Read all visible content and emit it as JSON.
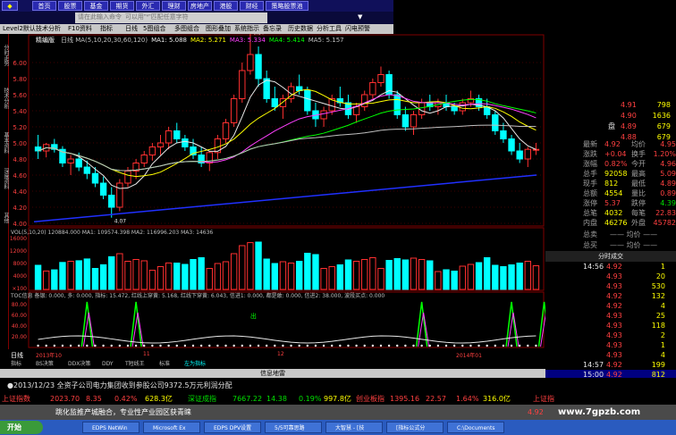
{
  "menubar": {
    "buttons": [
      "首页",
      "股票",
      "基金",
      "期货",
      "外汇",
      "理财",
      "房地产",
      "港股",
      "财经",
      "策略股票池"
    ]
  },
  "cmdbar": {
    "placeholder": "请在此输入命令  可以用\"*\"匹配任意字符",
    "dropdown": "▼"
  },
  "toolbar": {
    "items": [
      "Level2默认",
      "技术分析",
      "F10资料",
      "指标",
      "日线",
      "5图组合",
      "多图组合",
      "图形叠加",
      "系统指示",
      "备忘录",
      "历史数据",
      "分析工具",
      "闪电预警"
    ]
  },
  "lefttabs": [
    "分时走势",
    "技术分析",
    "基本资料",
    "深度资料",
    "其他"
  ],
  "chart": {
    "code_label": "精编版",
    "ma_legend": [
      {
        "text": "日线 MA(5,10,20,30,60,120)",
        "color": "#c0c0c0"
      },
      {
        "text": "MA1: 5.088",
        "color": "#e8e8e8"
      },
      {
        "text": "MA2: 5.271",
        "color": "#ffff00"
      },
      {
        "text": "MA3: 5.334",
        "color": "#ff40ff"
      },
      {
        "text": "MA4: 5.414",
        "color": "#00ff00"
      },
      {
        "text": "MA5: 5.157",
        "color": "#c0c0c0"
      }
    ],
    "price_ticks": [
      "6.00",
      "5.80",
      "5.60",
      "5.40",
      "5.20",
      "5.00",
      "4.80",
      "4.60",
      "4.40",
      "4.20",
      "4.00"
    ],
    "high_label": "6.37",
    "low_label": "4.07",
    "vol_legend": "VOL(5,10,20) 120884.000  MA1: 109574.398  MA2: 116996.203  MA3: 14636",
    "vol_ticks": [
      "16000",
      "12000",
      "8000",
      "4000",
      "×100"
    ],
    "ind_legend": "TOC信息 备银: 0.000, 多: 0.000, 指标: 15.472, 红线上穿黄: 5.168, 红线下穿黄: 6.043, 信进1: 0.000, 都是敢: 0.000, 信进2: 38.000, 波段买点: 0.000",
    "ind_ticks": [
      "80.00",
      "60.00",
      "40.00",
      "20.00"
    ],
    "ind_marker": "出",
    "date_labels": [
      "2013年10",
      "11",
      "12",
      "2014年01"
    ],
    "period_label": "日线"
  },
  "chart_data": {
    "type": "candlestick",
    "y_range": [
      4.0,
      6.2
    ],
    "candles": [
      [
        4.95,
        5.1,
        4.8,
        4.9
      ],
      [
        4.9,
        5.0,
        4.82,
        4.98
      ],
      [
        4.98,
        5.05,
        4.88,
        4.92
      ],
      [
        4.92,
        4.96,
        4.7,
        4.75
      ],
      [
        4.75,
        4.85,
        4.6,
        4.8
      ],
      [
        4.8,
        4.88,
        4.65,
        4.7
      ],
      [
        4.7,
        4.78,
        4.55,
        4.62
      ],
      [
        4.62,
        4.7,
        4.45,
        4.5
      ],
      [
        4.5,
        4.58,
        4.3,
        4.35
      ],
      [
        4.35,
        4.45,
        4.07,
        4.2
      ],
      [
        4.2,
        4.55,
        4.15,
        4.5
      ],
      [
        4.5,
        4.7,
        4.45,
        4.65
      ],
      [
        4.65,
        4.8,
        4.55,
        4.75
      ],
      [
        4.75,
        4.9,
        4.7,
        4.85
      ],
      [
        4.85,
        5.0,
        4.78,
        4.95
      ],
      [
        4.95,
        5.1,
        4.85,
        5.0
      ],
      [
        5.0,
        5.2,
        4.92,
        5.15
      ],
      [
        5.15,
        5.25,
        5.0,
        5.05
      ],
      [
        5.05,
        5.1,
        4.9,
        4.95
      ],
      [
        4.95,
        5.05,
        4.8,
        4.85
      ],
      [
        4.85,
        4.95,
        4.7,
        4.75
      ],
      [
        4.75,
        4.9,
        4.65,
        4.88
      ],
      [
        4.88,
        5.1,
        4.8,
        5.05
      ],
      [
        5.05,
        5.3,
        5.0,
        5.25
      ],
      [
        5.25,
        5.6,
        5.2,
        5.55
      ],
      [
        5.55,
        6.0,
        5.5,
        5.9
      ],
      [
        5.9,
        6.37,
        5.85,
        6.1
      ],
      [
        6.1,
        6.2,
        5.7,
        5.8
      ],
      [
        5.8,
        5.9,
        5.5,
        5.55
      ],
      [
        5.55,
        5.7,
        5.4,
        5.45
      ],
      [
        5.45,
        5.6,
        5.3,
        5.55
      ],
      [
        5.55,
        5.75,
        5.5,
        5.7
      ],
      [
        5.7,
        5.85,
        5.6,
        5.65
      ],
      [
        5.65,
        5.7,
        5.35,
        5.4
      ],
      [
        5.4,
        5.5,
        5.2,
        5.3
      ],
      [
        5.3,
        5.45,
        5.2,
        5.4
      ],
      [
        5.4,
        5.6,
        5.35,
        5.55
      ],
      [
        5.55,
        5.7,
        5.45,
        5.5
      ],
      [
        5.5,
        5.6,
        5.3,
        5.35
      ],
      [
        5.35,
        5.5,
        5.25,
        5.45
      ],
      [
        5.45,
        5.65,
        5.4,
        5.6
      ],
      [
        5.6,
        5.8,
        5.55,
        5.75
      ],
      [
        5.75,
        5.95,
        5.7,
        5.85
      ],
      [
        5.85,
        5.9,
        5.55,
        5.6
      ],
      [
        5.6,
        5.65,
        5.3,
        5.35
      ],
      [
        5.35,
        5.45,
        5.15,
        5.2
      ],
      [
        5.2,
        5.4,
        5.1,
        5.35
      ],
      [
        5.35,
        5.55,
        5.3,
        5.5
      ],
      [
        5.5,
        5.6,
        5.4,
        5.45
      ],
      [
        5.45,
        5.55,
        5.35,
        5.5
      ],
      [
        5.5,
        5.6,
        5.4,
        5.45
      ],
      [
        5.45,
        5.5,
        5.35,
        5.4
      ],
      [
        5.4,
        5.55,
        5.35,
        5.5
      ],
      [
        5.5,
        5.65,
        5.45,
        5.55
      ],
      [
        5.55,
        5.6,
        5.4,
        5.45
      ],
      [
        5.45,
        5.55,
        5.3,
        5.35
      ],
      [
        5.35,
        5.4,
        5.1,
        5.15
      ],
      [
        5.15,
        5.25,
        5.0,
        5.05
      ],
      [
        5.05,
        5.1,
        4.85,
        4.9
      ],
      [
        4.9,
        5.0,
        4.75,
        4.8
      ],
      [
        4.8,
        4.95,
        4.7,
        4.92
      ],
      [
        4.92,
        5.0,
        4.85,
        4.92
      ]
    ]
  },
  "rightpanel": {
    "title": "",
    "order_book": [
      {
        "side": "",
        "price": "4.91",
        "vol": "798"
      },
      {
        "side": "",
        "price": "4.90",
        "vol": "1636"
      },
      {
        "side": "盘",
        "price": "4.89",
        "vol": "679"
      },
      {
        "side": "",
        "price": "4.88",
        "vol": "679"
      }
    ],
    "stats": [
      {
        "l1": "最新",
        "v1": "4.92",
        "l2": "均价",
        "v2": "4.95"
      },
      {
        "l1": "涨跌",
        "v1": "+0.04",
        "l2": "换手",
        "v2": "1.20%"
      },
      {
        "l1": "涨幅",
        "v1": "0.82%",
        "l2": "今开",
        "v2": "4.96"
      },
      {
        "l1": "总手",
        "v1": "92058",
        "l2": "最高",
        "v2": "5.09"
      },
      {
        "l1": "现手",
        "v1": "812",
        "l2": "最低",
        "v2": "4.89"
      },
      {
        "l1": "总额",
        "v1": "4554",
        "l2": "量比",
        "v2": "0.89"
      },
      {
        "l1": "涨停",
        "v1": "5.37",
        "l2": "跌停",
        "v2": "4.39"
      },
      {
        "l1": "总笔",
        "v1": "4032",
        "l2": "每笔",
        "v2": "22.83"
      },
      {
        "l1": "内盘",
        "v1": "46276",
        "l2": "外盘",
        "v2": "45782"
      }
    ],
    "sell_label": "总卖",
    "buy_label": "总买",
    "dash": "——  均价  ——",
    "trades_header": "分时成交",
    "trades": [
      {
        "time": "14:56",
        "price": "4.92",
        "vol": "1"
      },
      {
        "time": "",
        "price": "4.93",
        "vol": "20"
      },
      {
        "time": "",
        "price": "4.93",
        "vol": "530"
      },
      {
        "time": "",
        "price": "4.92",
        "vol": "132"
      },
      {
        "time": "",
        "price": "4.92",
        "vol": "4"
      },
      {
        "time": "",
        "price": "4.93",
        "vol": "25"
      },
      {
        "time": "",
        "price": "4.93",
        "vol": "118"
      },
      {
        "time": "",
        "price": "4.93",
        "vol": "2"
      },
      {
        "time": "",
        "price": "4.93",
        "vol": "1"
      },
      {
        "time": "",
        "price": "4.93",
        "vol": "4"
      },
      {
        "time": "14:57",
        "price": "4.92",
        "vol": "199"
      },
      {
        "time": "15:00",
        "price": "4.92",
        "vol": "812"
      }
    ]
  },
  "bottomtabs": [
    "指标",
    "BS决策",
    "DDX决策",
    "DDY",
    "T短线王",
    "标准",
    "左为指标"
  ],
  "infobar": "信息地雷",
  "news": "●2013/12/23  全资子公司电力集团收到参股公司9372.5万元利润分配",
  "indexbar": [
    {
      "text": "上证指数",
      "color": "#ff4040"
    },
    {
      "text": "2023.70",
      "color": "#ff4040"
    },
    {
      "text": "8.35",
      "color": "#ff4040"
    },
    {
      "text": "0.42%",
      "color": "#ff4040"
    },
    {
      "text": "628.3亿",
      "color": "#ffff00"
    },
    {
      "text": "深证成指",
      "color": "#00e000"
    },
    {
      "text": "7667.22",
      "color": "#00e000"
    },
    {
      "text": "14.38",
      "color": "#00e000"
    },
    {
      "text": "0.19%",
      "color": "#00e000"
    },
    {
      "text": "997.8亿",
      "color": "#ffff00"
    },
    {
      "text": "创业板指",
      "color": "#ff4040"
    },
    {
      "text": "1395.16",
      "color": "#ff4040"
    },
    {
      "text": "22.57",
      "color": "#ff4040"
    },
    {
      "text": "1.64%",
      "color": "#ff4040"
    },
    {
      "text": "316.0亿",
      "color": "#ffff00"
    },
    {
      "text": "上证指",
      "color": "#ff4040"
    }
  ],
  "adbar": {
    "text": "跳化监推产城融合，专业性产业园区获青睐",
    "right": "4.92"
  },
  "taskbar": {
    "start": "开始",
    "buttons": [
      "EDPS NetWin",
      "Microsoft Ex",
      "EDPS DPV设置",
      "5/5可靠思路",
      "大智慧 - [技",
      "[指标公式分",
      "C:\\Documents"
    ]
  },
  "watermark": "www.7gpzb.com"
}
